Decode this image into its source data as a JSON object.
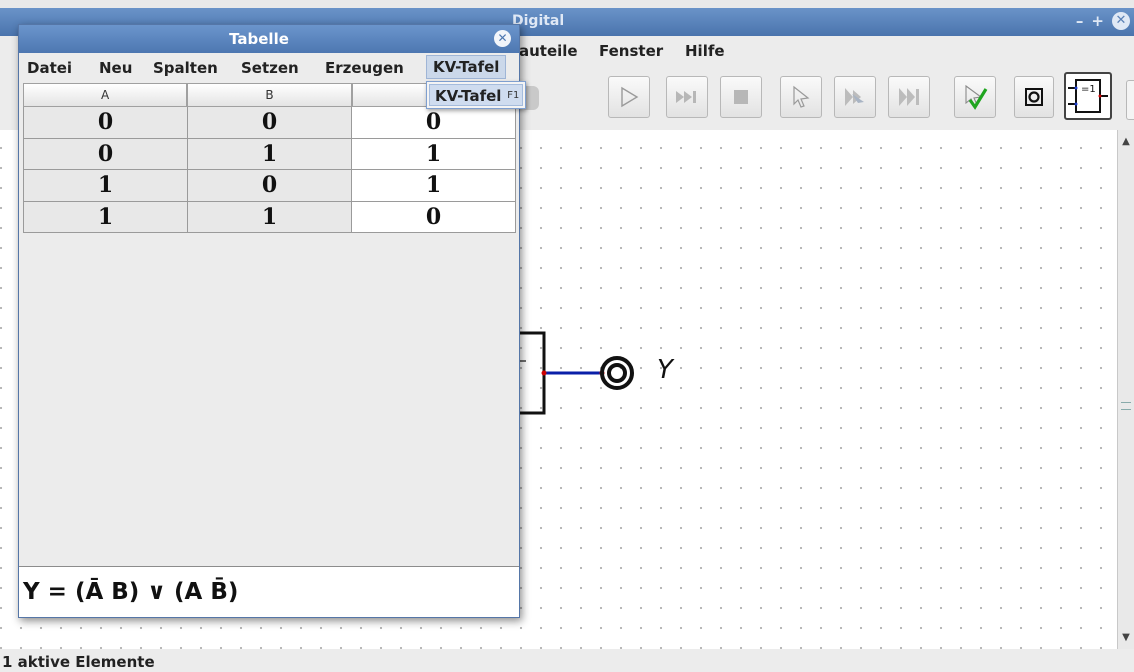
{
  "main_window": {
    "title": "Digital",
    "controls": {
      "minimize": "–",
      "maximize": "+",
      "close": "✕"
    },
    "menu_visible": [
      "auteile",
      "Fenster",
      "Hilfe"
    ],
    "toolbar_icons": [
      "save-icon",
      "run-icon",
      "step-forward-icon",
      "stop-icon",
      "select-icon",
      "micro-step-icon",
      "fast-run-icon",
      "analyse-check-icon",
      "probe-icon",
      "xor-gate-icon"
    ],
    "xor_label": "=1",
    "status": "1 aktive Elemente"
  },
  "circuit": {
    "output_label": "Y",
    "wire_color": "#0a1fa8",
    "pin_color": "#cc0000"
  },
  "table_dialog": {
    "title": "Tabelle",
    "menu": [
      "Datei",
      "Neu",
      "Spalten",
      "Setzen",
      "Erzeugen",
      "KV-Tafel"
    ],
    "open_menu": "KV-Tafel",
    "columns": [
      "A",
      "B",
      ""
    ],
    "rows": [
      [
        "0",
        "0",
        "0"
      ],
      [
        "0",
        "1",
        "1"
      ],
      [
        "1",
        "0",
        "1"
      ],
      [
        "1",
        "1",
        "0"
      ]
    ],
    "expression": "Y = (Ā B) ∨ (A B̄)"
  },
  "popup_menu": {
    "item_label": "KV-Tafel",
    "accelerator": "F1"
  }
}
